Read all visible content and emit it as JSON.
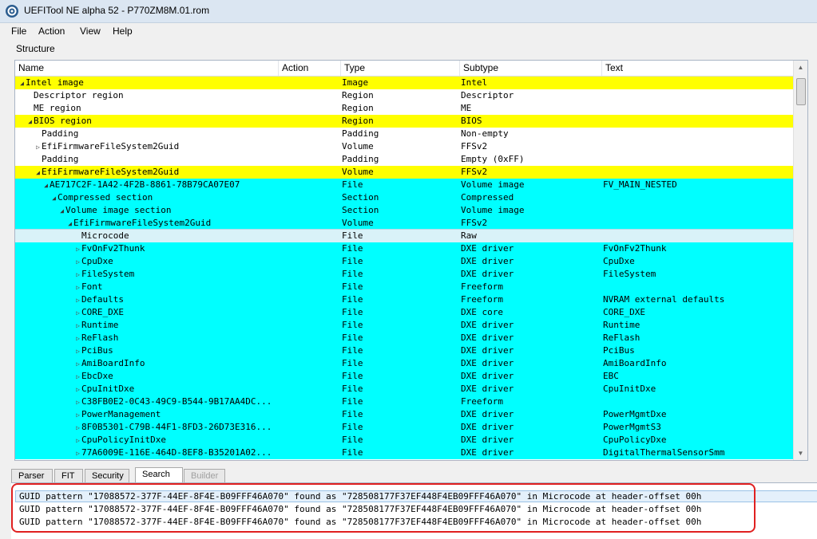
{
  "window": {
    "title": "UEFITool NE alpha 52 - P770ZM8M.01.rom"
  },
  "menu": {
    "items": [
      "File",
      "Action",
      "View",
      "Help"
    ]
  },
  "structure": {
    "label": "Structure",
    "columns": [
      "Name",
      "Action",
      "Type",
      "Subtype",
      "Text"
    ],
    "rows": [
      {
        "name": "Intel image",
        "type": "Image",
        "subtype": "Intel",
        "text": "",
        "arrow": "▲"
      },
      {
        "name": "Descriptor region",
        "type": "Region",
        "subtype": "Descriptor",
        "text": "",
        "arrow": ""
      },
      {
        "name": "ME region",
        "type": "Region",
        "subtype": "ME",
        "text": "",
        "arrow": ""
      },
      {
        "name": "BIOS region",
        "type": "Region",
        "subtype": "BIOS",
        "text": "",
        "arrow": "▲"
      },
      {
        "name": "Padding",
        "type": "Padding",
        "subtype": "Non-empty",
        "text": "",
        "arrow": ""
      },
      {
        "name": "EfiFirmwareFileSystem2Guid",
        "type": "Volume",
        "subtype": "FFSv2",
        "text": "",
        "arrow": "▷"
      },
      {
        "name": "Padding",
        "type": "Padding",
        "subtype": "Empty (0xFF)",
        "text": "",
        "arrow": ""
      },
      {
        "name": "EfiFirmwareFileSystem2Guid",
        "type": "Volume",
        "subtype": "FFSv2",
        "text": "",
        "arrow": "▲"
      },
      {
        "name": "AE717C2F-1A42-4F2B-8861-78B79CA07E07",
        "type": "File",
        "subtype": "Volume image",
        "text": "FV_MAIN_NESTED",
        "arrow": "▲"
      },
      {
        "name": "Compressed section",
        "type": "Section",
        "subtype": "Compressed",
        "text": "",
        "arrow": "▲"
      },
      {
        "name": "Volume image section",
        "type": "Section",
        "subtype": "Volume image",
        "text": "",
        "arrow": "▲"
      },
      {
        "name": "EfiFirmwareFileSystem2Guid",
        "type": "Volume",
        "subtype": "FFSv2",
        "text": "",
        "arrow": "▲"
      },
      {
        "name": "Microcode",
        "type": "File",
        "subtype": "Raw",
        "text": "",
        "arrow": ""
      },
      {
        "name": "FvOnFv2Thunk",
        "type": "File",
        "subtype": "DXE driver",
        "text": "FvOnFv2Thunk",
        "arrow": "▷"
      },
      {
        "name": "CpuDxe",
        "type": "File",
        "subtype": "DXE driver",
        "text": "CpuDxe",
        "arrow": "▷"
      },
      {
        "name": "FileSystem",
        "type": "File",
        "subtype": "DXE driver",
        "text": "FileSystem",
        "arrow": "▷"
      },
      {
        "name": "Font",
        "type": "File",
        "subtype": "Freeform",
        "text": "",
        "arrow": "▷"
      },
      {
        "name": "Defaults",
        "type": "File",
        "subtype": "Freeform",
        "text": "NVRAM external defaults",
        "arrow": "▷"
      },
      {
        "name": "CORE_DXE",
        "type": "File",
        "subtype": "DXE core",
        "text": "CORE_DXE",
        "arrow": "▷"
      },
      {
        "name": "Runtime",
        "type": "File",
        "subtype": "DXE driver",
        "text": "Runtime",
        "arrow": "▷"
      },
      {
        "name": "ReFlash",
        "type": "File",
        "subtype": "DXE driver",
        "text": "ReFlash",
        "arrow": "▷"
      },
      {
        "name": "PciBus",
        "type": "File",
        "subtype": "DXE driver",
        "text": "PciBus",
        "arrow": "▷"
      },
      {
        "name": "AmiBoardInfo",
        "type": "File",
        "subtype": "DXE driver",
        "text": "AmiBoardInfo",
        "arrow": "▷"
      },
      {
        "name": "EbcDxe",
        "type": "File",
        "subtype": "DXE driver",
        "text": "EBC",
        "arrow": "▷"
      },
      {
        "name": "CpuInitDxe",
        "type": "File",
        "subtype": "DXE driver",
        "text": "CpuInitDxe",
        "arrow": "▷"
      },
      {
        "name": "C38FB0E2-0C43-49C9-B544-9B17AA4DC...",
        "type": "File",
        "subtype": "Freeform",
        "text": "",
        "arrow": "▷"
      },
      {
        "name": "PowerManagement",
        "type": "File",
        "subtype": "DXE driver",
        "text": "PowerMgmtDxe",
        "arrow": "▷"
      },
      {
        "name": "8F0B5301-C79B-44F1-8FD3-26D73E316...",
        "type": "File",
        "subtype": "DXE driver",
        "text": "PowerMgmtS3",
        "arrow": "▷"
      },
      {
        "name": "CpuPolicyInitDxe",
        "type": "File",
        "subtype": "DXE driver",
        "text": "CpuPolicyDxe",
        "arrow": "▷"
      },
      {
        "name": "77A6009E-116E-464D-8EF8-B35201A02...",
        "type": "File",
        "subtype": "DXE driver",
        "text": "DigitalThermalSensorSmm",
        "arrow": "▷"
      }
    ]
  },
  "tabs": [
    "Parser",
    "FIT",
    "Security",
    "Search",
    "Builder"
  ],
  "messages": [
    "GUID pattern \"17088572-377F-44EF-8F4E-B09FFF46A070\" found as \"728508177F37EF448F4EB09FFF46A070\" in Microcode at header-offset 00h",
    "GUID pattern \"17088572-377F-44EF-8F4E-B09FFF46A070\" found as \"728508177F37EF448F4EB09FFF46A070\" in Microcode at header-offset 00h",
    "GUID pattern \"17088572-377F-44EF-8F4E-B09FFF46A070\" found as \"728508177F37EF448F4EB09FFF46A070\" in Microcode at header-offset 00h"
  ],
  "colors": {
    "highlight_yellow": "#ffff00",
    "highlight_cyan": "#00ffff",
    "annotation_red": "#e02020"
  },
  "icons": {
    "app": "gear-icon",
    "scroll_up": "scroll-up-icon",
    "scroll_down": "scroll-down-icon"
  }
}
